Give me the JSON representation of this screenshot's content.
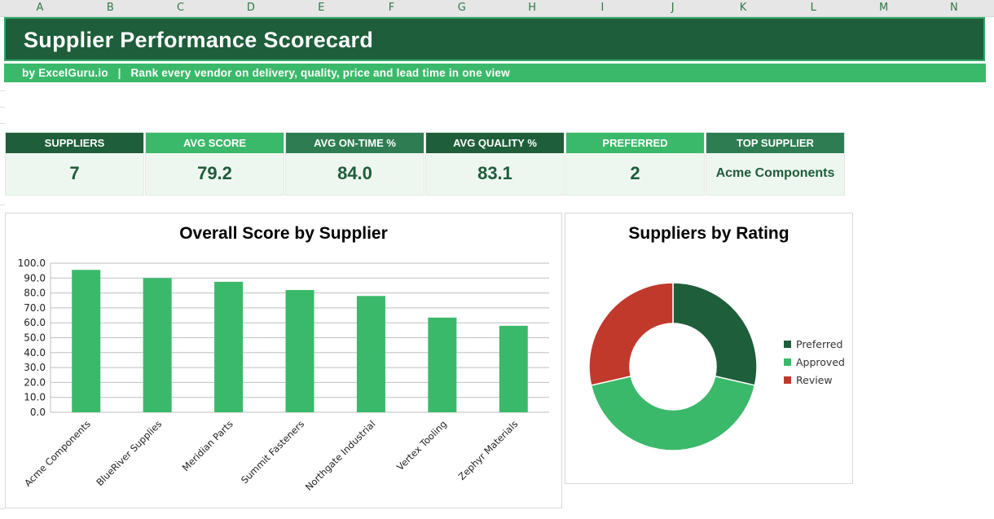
{
  "columns": [
    "A",
    "B",
    "C",
    "D",
    "E",
    "F",
    "G",
    "H",
    "I",
    "J",
    "K",
    "L",
    "M",
    "N"
  ],
  "title": "Supplier Performance Scorecard",
  "subtitle": "by ExcelGuru.io   |   Rank every vendor on delivery, quality, price and lead time in one view",
  "colors": {
    "dark_green": "#1e5e3b",
    "mid_green": "#2e7d52",
    "light_green": "#3bb96a",
    "review_red": "#c0392b"
  },
  "kpis": [
    {
      "label": "SUPPLIERS",
      "value": "7"
    },
    {
      "label": "AVG SCORE",
      "value": "79.2"
    },
    {
      "label": "AVG ON-TIME %",
      "value": "84.0"
    },
    {
      "label": "AVG QUALITY %",
      "value": "83.1"
    },
    {
      "label": "PREFERRED",
      "value": "2"
    },
    {
      "label": "TOP SUPPLIER",
      "value": "Acme Components"
    }
  ],
  "chart_data": [
    {
      "type": "bar",
      "title": "Overall Score by Supplier",
      "categories": [
        "Acme Components",
        "BlueRiver Supplies",
        "Meridian Parts",
        "Summit Fasteners",
        "Northgate Industrial",
        "Vertex Tooling",
        "Zephyr Materials"
      ],
      "values": [
        95.5,
        90.0,
        87.5,
        82.0,
        78.0,
        63.5,
        58.0
      ],
      "ylim": [
        0,
        100
      ],
      "yticks": [
        "0.0",
        "10.0",
        "20.0",
        "30.0",
        "40.0",
        "50.0",
        "60.0",
        "70.0",
        "80.0",
        "90.0",
        "100.0"
      ],
      "color": "#3bb96a",
      "grid": true
    },
    {
      "type": "pie",
      "title": "Suppliers by Rating",
      "labels": [
        "Preferred",
        "Approved",
        "Review"
      ],
      "values": [
        2,
        3,
        2
      ],
      "colors": [
        "#1e5e3b",
        "#3bb96a",
        "#c0392b"
      ],
      "legend": "right"
    }
  ]
}
